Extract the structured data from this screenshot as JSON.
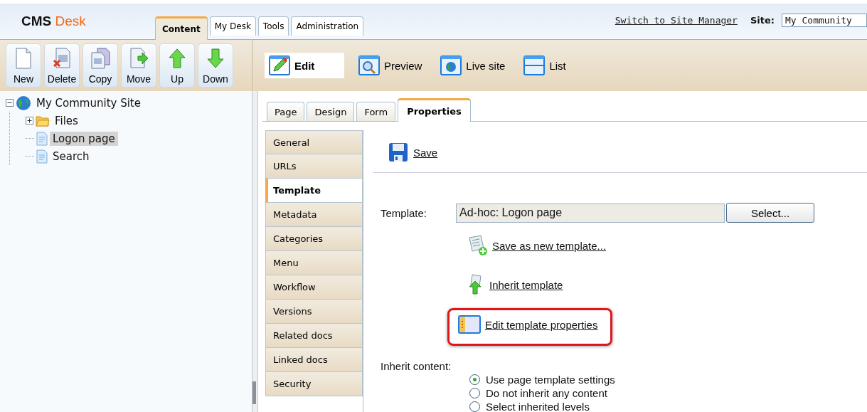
{
  "header": {
    "logo": {
      "brand": "CMS",
      "product": "Desk"
    },
    "main_tabs": [
      {
        "label": "Content",
        "selected": true
      },
      {
        "label": "My Desk",
        "selected": false
      },
      {
        "label": "Tools",
        "selected": false
      },
      {
        "label": "Administration",
        "selected": false
      }
    ],
    "switch_link": "Switch to Site Manager",
    "site_label": "Site:",
    "site_value": "My Community"
  },
  "toolbar": {
    "actions": [
      {
        "label": "New",
        "kind": "new"
      },
      {
        "label": "Delete",
        "kind": "delete"
      },
      {
        "label": "Copy",
        "kind": "copy"
      },
      {
        "label": "Move",
        "kind": "move"
      },
      {
        "label": "Up",
        "kind": "up"
      },
      {
        "label": "Down",
        "kind": "down"
      }
    ],
    "view_modes": [
      {
        "label": "Edit",
        "kind": "edit",
        "selected": true
      },
      {
        "label": "Preview",
        "kind": "preview",
        "selected": false
      },
      {
        "label": "Live site",
        "kind": "live",
        "selected": false
      },
      {
        "label": "List",
        "kind": "list",
        "selected": false
      }
    ]
  },
  "tree": {
    "label": "My Community Site",
    "kind": "site",
    "expanded": true,
    "selected": false,
    "children": [
      {
        "label": "Files",
        "kind": "folder",
        "expanded": false,
        "selected": false
      },
      {
        "label": "Logon page",
        "kind": "page",
        "selected": true
      },
      {
        "label": "Search",
        "kind": "page",
        "selected": false
      }
    ]
  },
  "sub_tabs": [
    {
      "label": "Page",
      "selected": false
    },
    {
      "label": "Design",
      "selected": false
    },
    {
      "label": "Form",
      "selected": false
    },
    {
      "label": "Properties",
      "selected": true
    }
  ],
  "side_menu": [
    {
      "label": "General",
      "selected": false
    },
    {
      "label": "URLs",
      "selected": false
    },
    {
      "label": "Template",
      "selected": true
    },
    {
      "label": "Metadata",
      "selected": false
    },
    {
      "label": "Categories",
      "selected": false
    },
    {
      "label": "Menu",
      "selected": false
    },
    {
      "label": "Workflow",
      "selected": false
    },
    {
      "label": "Versions",
      "selected": false
    },
    {
      "label": "Related docs",
      "selected": false
    },
    {
      "label": "Linked docs",
      "selected": false
    },
    {
      "label": "Security",
      "selected": false
    }
  ],
  "save_link": "Save",
  "template": {
    "label": "Template:",
    "value": "Ad-hoc: Logon page",
    "select_button": "Select...",
    "actions": [
      {
        "label": "Save as new template...",
        "kind": "save-new",
        "highlighted": false
      },
      {
        "label": "Inherit template",
        "kind": "inherit",
        "highlighted": false
      },
      {
        "label": "Edit template properties",
        "kind": "edit-props",
        "highlighted": true
      }
    ]
  },
  "inherit": {
    "label": "Inherit content:",
    "options": [
      {
        "label": "Use page template settings",
        "selected": true
      },
      {
        "label": "Do not inherit any content",
        "selected": false
      },
      {
        "label": "Select inherited levels",
        "selected": false
      }
    ]
  }
}
